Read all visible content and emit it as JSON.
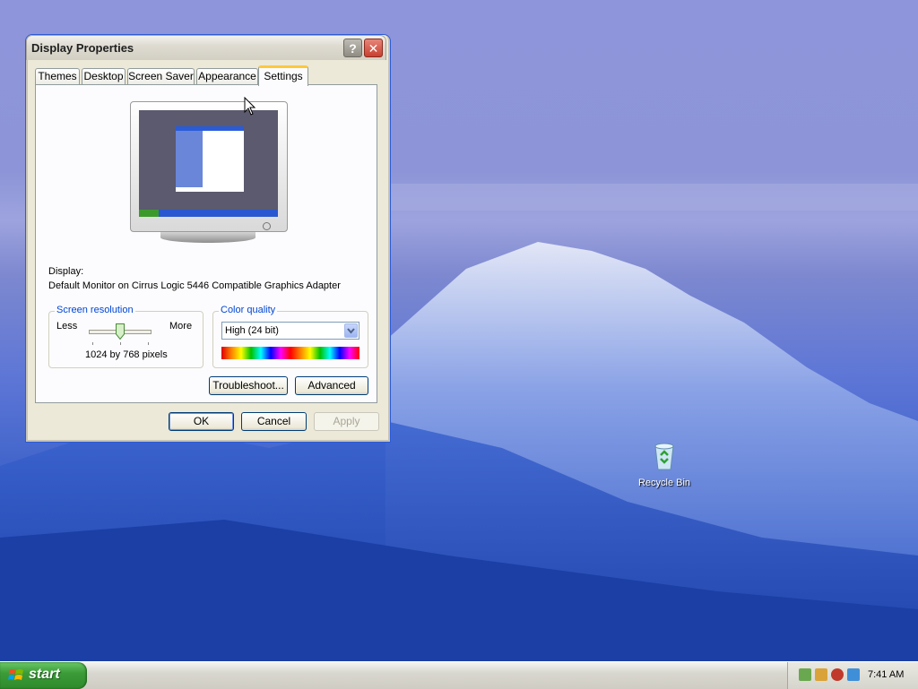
{
  "window": {
    "title": "Display Properties",
    "help_glyph": "?",
    "close_glyph": "✕"
  },
  "tabs": [
    {
      "label": "Themes"
    },
    {
      "label": "Desktop"
    },
    {
      "label": "Screen Saver"
    },
    {
      "label": "Appearance"
    },
    {
      "label": "Settings",
      "active": true
    }
  ],
  "settings": {
    "display_label": "Display:",
    "display_value": "Default Monitor on Cirrus Logic 5446 Compatible Graphics Adapter",
    "screen_resolution": {
      "legend": "Screen resolution",
      "less": "Less",
      "more": "More",
      "value": "1024 by 768 pixels"
    },
    "color_quality": {
      "legend": "Color quality",
      "selected": "High (24 bit)"
    },
    "troubleshoot_label": "Troubleshoot...",
    "advanced_label": "Advanced"
  },
  "dialog_buttons": {
    "ok": "OK",
    "cancel": "Cancel",
    "apply": "Apply"
  },
  "desktop": {
    "recycle_bin_label": "Recycle Bin"
  },
  "taskbar": {
    "start_label": "start",
    "clock": "7:41 AM"
  },
  "colors": {
    "tab_highlight": "#ffc83c",
    "group_legend": "#0046d5",
    "start_green": "#3c9c38",
    "taskbar": "#d8d7cf"
  }
}
